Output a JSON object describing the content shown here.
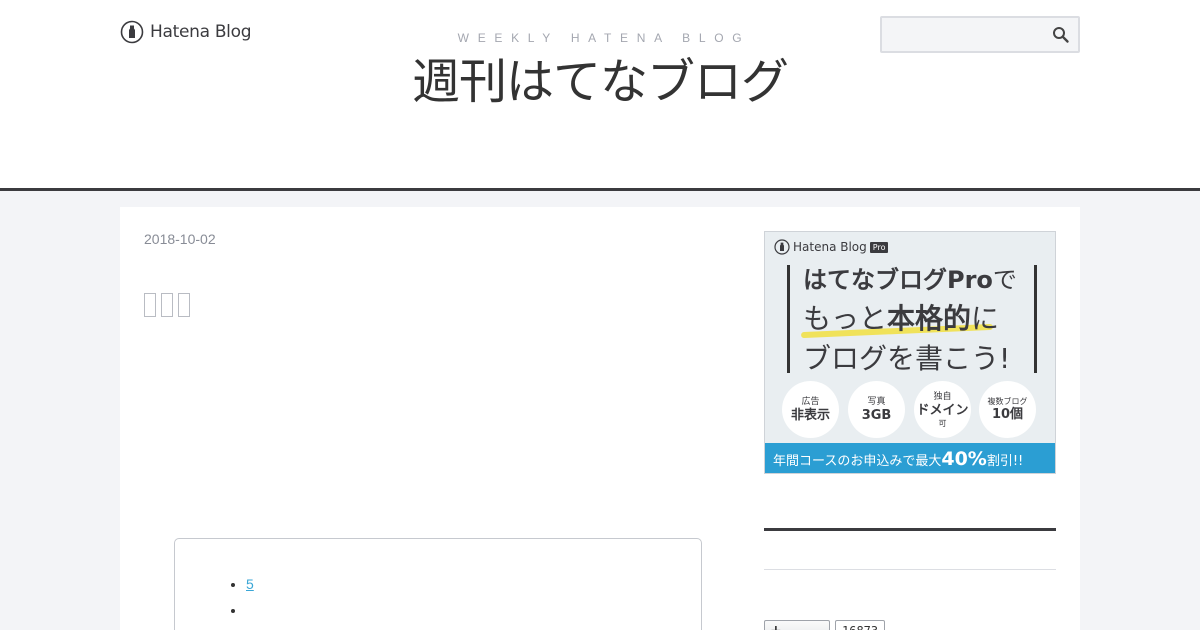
{
  "header": {
    "logo_text": "Hatena Blog",
    "subtitle": "WEEKLY HATENA BLOG",
    "title": "週刊はてなブログ",
    "search": {
      "placeholder": "",
      "value": ""
    }
  },
  "entry": {
    "date": "2018-10-02",
    "title_glyph_count": 3,
    "toc_items": [
      {
        "label": "5"
      },
      {
        "label": ""
      },
      {
        "label": ""
      }
    ]
  },
  "sidebar": {
    "pro_banner": {
      "logo_text": "Hatena Blog",
      "tag": "Pro",
      "line1_bold": "はてなブログPro",
      "line1_tail": "で",
      "line2_pre": "もっと",
      "line2_bold": "本格的",
      "line2_tail": "に",
      "line3": "ブログを書こう!",
      "features": [
        {
          "small": "広告",
          "big": "非表示",
          "tiny": ""
        },
        {
          "small": "写真",
          "big": "3GB",
          "tiny": ""
        },
        {
          "small": "独自",
          "big": "ドメイン",
          "tiny": "可"
        },
        {
          "small": "複数ブログ",
          "big": "10個",
          "tiny": ""
        }
      ],
      "footer_pre": "年間コースのお申込みで最大",
      "footer_big": "40%",
      "footer_post": "割引!!"
    },
    "follow": {
      "button_label": "+",
      "count": "16873"
    }
  },
  "colors": {
    "accent": "#2b9ed3",
    "link": "#3aa6d6",
    "dark": "#3b3b3f",
    "highlight": "#f0e25a"
  }
}
